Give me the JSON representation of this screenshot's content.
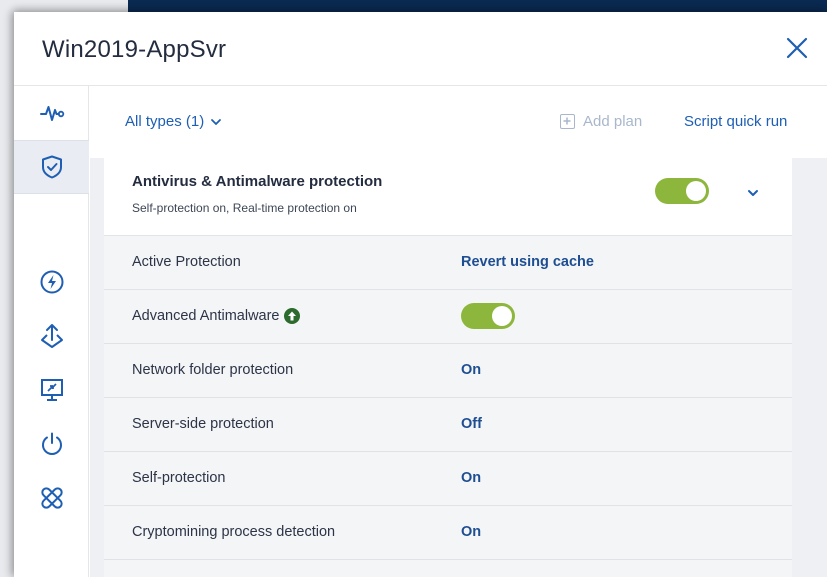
{
  "window": {
    "title": "Win2019-AppSvr"
  },
  "rail": {
    "items": [
      {
        "icon": "activity-pulse-icon"
      },
      {
        "icon": "shield-check-icon",
        "active": true
      },
      {
        "icon": "lightning-icon"
      },
      {
        "icon": "patch-management-icon"
      },
      {
        "icon": "remote-desktop-icon"
      },
      {
        "icon": "power-icon"
      },
      {
        "icon": "bandage-icon"
      }
    ]
  },
  "toolbar": {
    "types_label": "All types (1)",
    "add_plan_label": "Add plan",
    "script_run_label": "Script quick run"
  },
  "plan": {
    "title": "Antivirus & Antimalware protection",
    "subtitle": "Self-protection on, Real-time protection on",
    "enabled": true,
    "settings": [
      {
        "label": "Active Protection",
        "value": "Revert using cache"
      },
      {
        "label": "Advanced Antimalware",
        "value": "",
        "toggle": true,
        "upgrade_icon": "upgrade-arrow-icon"
      },
      {
        "label": "Network folder protection",
        "value": "On"
      },
      {
        "label": "Server-side protection",
        "value": "Off"
      },
      {
        "label": "Self-protection",
        "value": "On"
      },
      {
        "label": "Cryptomining process detection",
        "value": "On"
      }
    ]
  },
  "colors": {
    "accent_blue": "#1e5fb4",
    "toggle_green": "#8db63c",
    "value_blue": "#1e4e92"
  }
}
